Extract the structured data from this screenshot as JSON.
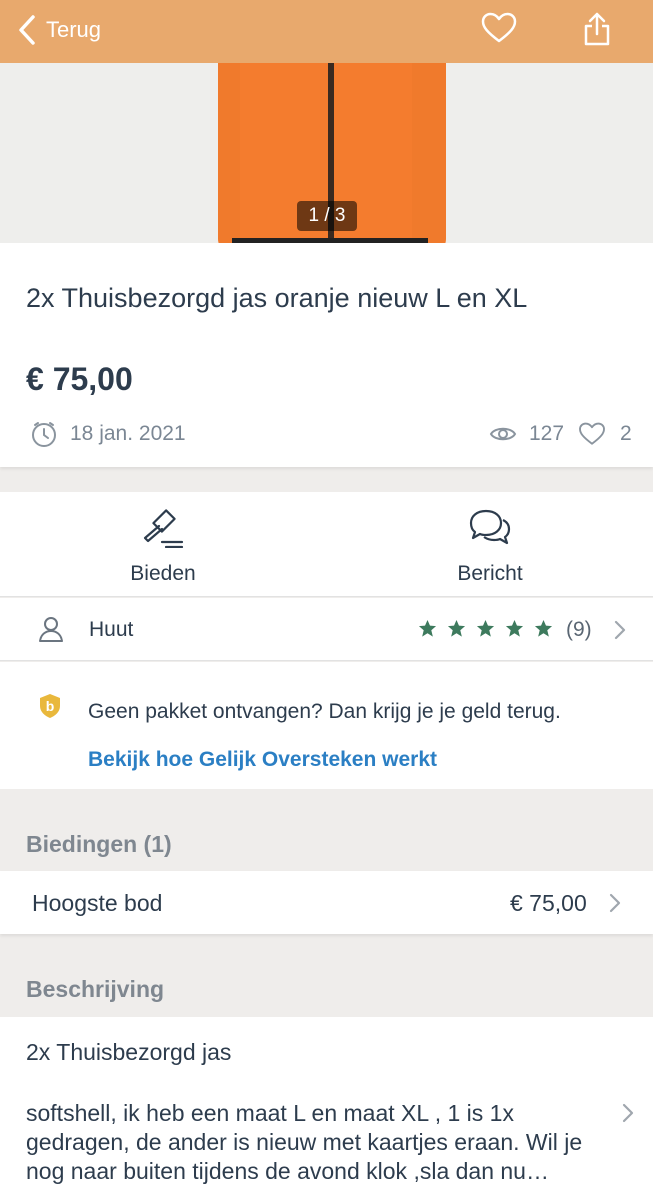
{
  "header": {
    "back_label": "Terug",
    "icons": [
      "chevron-left-icon",
      "heart-icon",
      "share-icon"
    ],
    "background_color": "#e8a96d"
  },
  "gallery": {
    "counter": "1 / 3"
  },
  "listing": {
    "title": "2x Thuisbezorgd jas oranje nieuw L en XL",
    "price": "€ 75,00",
    "date": "18 jan. 2021",
    "views": "127",
    "favorites": "2"
  },
  "actions": {
    "bid_label": "Bieden",
    "message_label": "Bericht"
  },
  "seller": {
    "name": "Huut",
    "rating_stars": 5,
    "rating_count": "(9)",
    "star_color": "#3d7a5d"
  },
  "protection": {
    "text": "Geen pakket ontvangen? Dan krijg je je geld terug.",
    "link": "Bekijk hoe Gelijk Oversteken werkt",
    "link_color": "#2b7fc4",
    "badge_color": "#e9b83c"
  },
  "bids": {
    "heading": "Biedingen (1)",
    "label": "Hoogste bod",
    "value": "€ 75,00"
  },
  "description": {
    "heading": "Beschrijving",
    "title": "2x Thuisbezorgd jas",
    "body": "softshell, ik heb een maat L en maat XL , 1 is 1x gedragen, de ander is nieuw met kaartjes eraan. Wil je nog naar buiten tijdens de avond klok ,sla dan nu…"
  }
}
